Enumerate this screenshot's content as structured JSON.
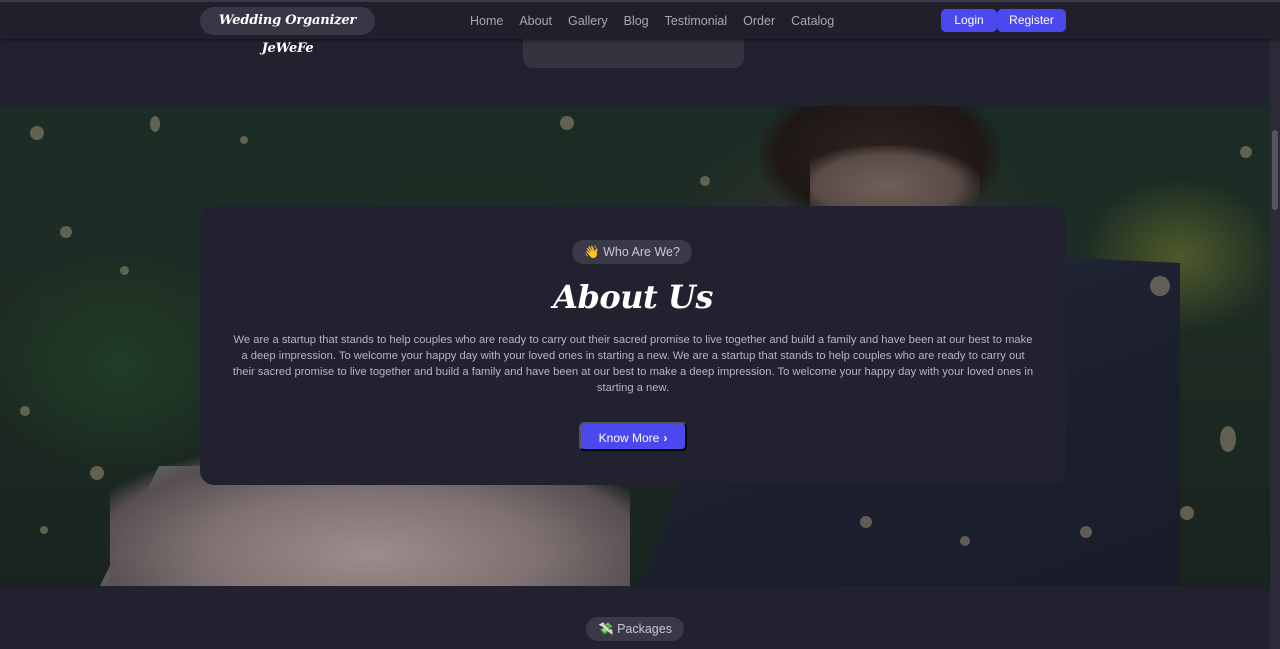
{
  "brand": {
    "name": "Wedding Organizer JeWeFe"
  },
  "nav": {
    "links": [
      "Home",
      "About",
      "Gallery",
      "Blog",
      "Testimonial",
      "Order",
      "Catalog"
    ],
    "login_label": "Login",
    "register_label": "Register"
  },
  "about": {
    "pill_icon": "👋",
    "pill_label": "Who Are We?",
    "title": "About Us",
    "text": "We are a startup that stands to help couples who are ready to carry out their sacred promise to live together and build a family and have been at our best to make a deep impression. To welcome your happy day with your loved ones in starting a new. We are a startup that stands to help couples who are ready to carry out their sacred promise to live together and build a family and have been at our best to make a deep impression. To welcome your happy day with your loved ones in starting a new.",
    "button_label": "Know More",
    "button_icon": "chevron-right-icon"
  },
  "packages": {
    "pill_icon": "💸",
    "pill_label": "Packages"
  },
  "colors": {
    "background": "#22212f",
    "accent": "#4b48f0",
    "navbar": "#201f2b"
  }
}
